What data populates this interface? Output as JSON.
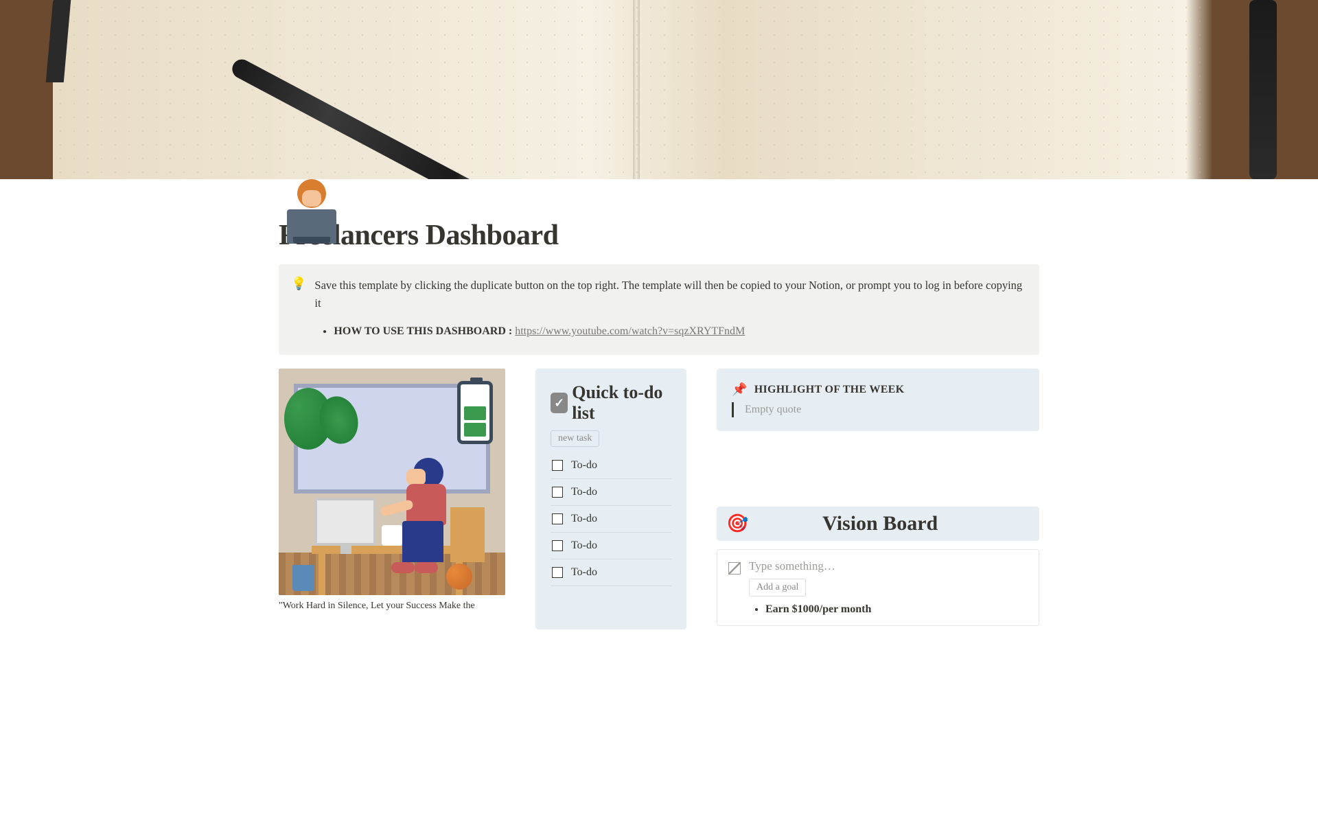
{
  "title": "Freelancers Dashboard",
  "callout": {
    "icon": "💡",
    "text": "Save this template by clicking the duplicate button on the top right. The template will then be copied to your Notion, or prompt you to log in before copying it",
    "howto_label": "HOW TO USE THIS DASHBOARD :",
    "howto_link": "https://www.youtube.com/watch?v=sqzXRYTFndM"
  },
  "figure": {
    "caption": "\"Work Hard in Silence, Let your Success Make the"
  },
  "todo": {
    "title": "Quick to-do list",
    "new_task_label": "new task",
    "items": [
      {
        "label": "To-do"
      },
      {
        "label": "To-do"
      },
      {
        "label": "To-do"
      },
      {
        "label": "To-do"
      },
      {
        "label": "To-do"
      }
    ]
  },
  "highlight": {
    "title": "HIGHLIGHT OF THE WEEK",
    "quote_placeholder": "Empty quote"
  },
  "vision": {
    "title": "Vision Board",
    "placeholder": "Type something…",
    "add_goal_label": "Add a goal",
    "goals": [
      {
        "label": "Earn $1000/per month"
      }
    ]
  }
}
